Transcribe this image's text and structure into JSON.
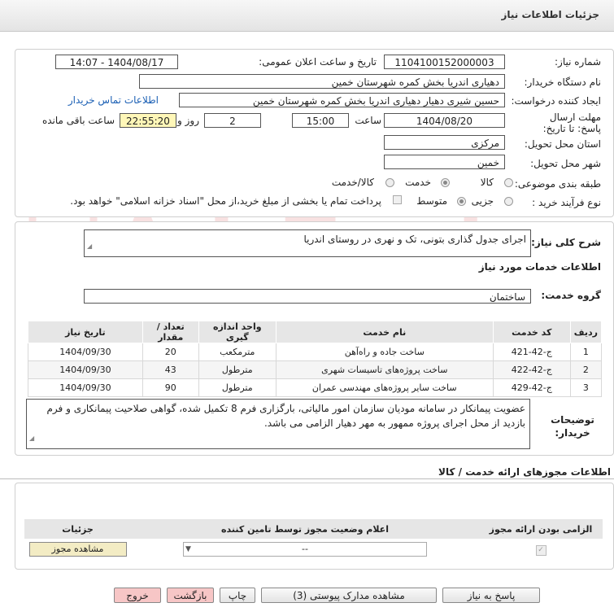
{
  "header": {
    "title": "جزئیات اطلاعات نیاز"
  },
  "fields": {
    "need_number_label": "شماره نیاز:",
    "need_number": "1104100152000003",
    "announce_label": "تاریخ و ساعت اعلان عمومی:",
    "announce_value": "1404/08/17 - 14:07",
    "buyer_org_label": "نام دستگاه خریدار:",
    "buyer_org": "دهیاری اندریا بخش کمره شهرستان خمین",
    "creator_label": "ایجاد کننده درخواست:",
    "creator": "حسین شیری دهیار دهیاری اندریا بخش کمره شهرستان خمین",
    "contact_link": "اطلاعات تماس خریدار",
    "deadline_label": "مهلت ارسال پاسخ: تا تاریخ:",
    "deadline_date": "1404/08/20",
    "time_label": "ساعت",
    "deadline_time": "15:00",
    "days_value": "2",
    "days_label": "روز و",
    "remaining_time": "22:55:20",
    "remaining_label": "ساعت باقی مانده",
    "province_label": "استان محل تحویل:",
    "province": "مرکزی",
    "city_label": "شهر محل تحویل:",
    "city": "خمین",
    "category_label": "طبقه بندی موضوعی:",
    "category_options": [
      "کالا",
      "خدمت",
      "کالا/خدمت"
    ],
    "process_label": "نوع فرآیند خرید :",
    "process_options": [
      "جزیی",
      "متوسط"
    ],
    "payment_note": "پرداخت تمام یا بخشی از مبلغ خرید،از محل \"اسناد خزانه اسلامی\" خواهد بود."
  },
  "summary": {
    "label": "شرح کلی نیاز:",
    "value": "اجرای جدول گذاری بتونی، تک و نهری در روستای اندریا"
  },
  "services": {
    "section_title": "اطلاعات خدمات مورد نیاز",
    "group_label": "گروه خدمت:",
    "group_value": "ساختمان",
    "columns": [
      "ردیف",
      "کد خدمت",
      "نام خدمت",
      "واحد اندازه گیری",
      "تعداد / مقدار",
      "تاریخ نیاز"
    ],
    "rows": [
      [
        "1",
        "ج-42-421",
        "ساخت جاده و راه‌آهن",
        "مترمکعب",
        "20",
        "1404/09/30"
      ],
      [
        "2",
        "ج-42-422",
        "ساخت پروژه‌های تاسیسات شهری",
        "مترطول",
        "43",
        "1404/09/30"
      ],
      [
        "3",
        "ج-42-429",
        "ساخت سایر پروژه‌های مهندسی عمران",
        "مترطول",
        "90",
        "1404/09/30"
      ]
    ]
  },
  "buyer_notes": {
    "label": "توضیحات خریدار:",
    "value": "عضویت پیمانکار در سامانه مودیان سازمان امور مالیاتی، بارگزاری فرم 8 تکمیل شده، گواهی صلاحیت پیمانکاری و فرم بازدید از محل اجرای پروژه ممهور به مهر دهیار الزامی می باشد."
  },
  "licenses": {
    "section_title": "اطلاعات مجوزهای ارائه خدمت / کالا",
    "columns": [
      "الزامی بودن ارائه مجوز",
      "اعلام وضعیت مجوز توسط تامین کننده",
      "جزئیات"
    ],
    "select_value": "--",
    "view_button": "مشاهده مجوز"
  },
  "buttons": {
    "reply": "پاسخ به نیاز",
    "attachments": "مشاهده مدارک پیوستی (3)",
    "print": "چاپ",
    "back": "بازگشت",
    "exit": "خروج"
  },
  "watermark": {
    "text": "AriaTender.net"
  },
  "colors": {
    "exit_bg": "#f7c6c6",
    "back_bg": "#f7c6c6",
    "yellow": "#fff7b8",
    "watermark": "#d33"
  }
}
